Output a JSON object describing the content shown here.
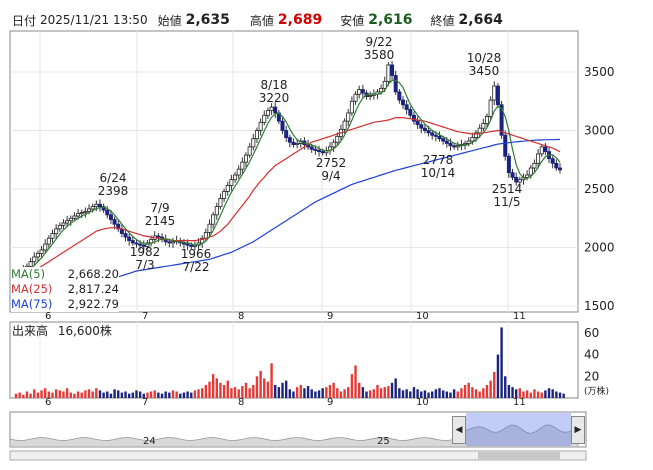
{
  "header": {
    "date_label": "日付",
    "datetime": "2025/11/21 13:50",
    "open_label": "始値",
    "open": "2,635",
    "high_label": "高値",
    "high": "2,689",
    "low_label": "安値",
    "low": "2,616",
    "close_label": "終値",
    "close": "2,664"
  },
  "colors": {
    "up": "#0a0a0a",
    "down_body": "#1a237e",
    "high": "#d50000",
    "low": "#1b5e20",
    "ma5": "#2e7d32",
    "ma25": "#d32f2f",
    "ma75": "#1e40d8",
    "vol_red": "#e53935",
    "vol_blue": "#1a237e"
  },
  "ma_legend": [
    {
      "name": "MA(5)",
      "value": "2,668.20"
    },
    {
      "name": "MA(25)",
      "value": "2,817.24"
    },
    {
      "name": "MA(75)",
      "value": "2,922.79"
    }
  ],
  "volume": {
    "label": "出来高",
    "value": "16,600株",
    "unit": "(万株)",
    "ticks": [
      "20",
      "40",
      "60"
    ]
  },
  "navigator": {
    "labels": [
      "24",
      "25"
    ]
  },
  "chart_data": {
    "type": "candlestick",
    "title": "",
    "x_month_labels": [
      "6",
      "7",
      "8",
      "9",
      "10",
      "11"
    ],
    "y_ticks": [
      1500,
      2000,
      2500,
      3000,
      3500
    ],
    "ylim": [
      1450,
      3850
    ],
    "annotations": [
      {
        "label": "6/24",
        "value": "2398"
      },
      {
        "label": "7/9",
        "value": "2145"
      },
      {
        "label": "1982",
        "value": "7/3"
      },
      {
        "label": "1966",
        "value": "7/22"
      },
      {
        "label": "8/18",
        "value": "3220"
      },
      {
        "label": "2752",
        "value": "9/4"
      },
      {
        "label": "9/22",
        "value": "3580"
      },
      {
        "label": "2778",
        "value": "10/14"
      },
      {
        "label": "10/28",
        "value": "3450"
      },
      {
        "label": "2514",
        "value": "11/5"
      }
    ],
    "close_series": [
      1760,
      1790,
      1810,
      1840,
      1880,
      1920,
      1950,
      1980,
      2030,
      2080,
      2120,
      2160,
      2190,
      2210,
      2230,
      2250,
      2270,
      2290,
      2300,
      2310,
      2330,
      2350,
      2370,
      2350,
      2320,
      2280,
      2240,
      2200,
      2160,
      2120,
      2090,
      2060,
      2040,
      2030,
      2020,
      2010,
      2040,
      2070,
      2100,
      2090,
      2070,
      2050,
      2040,
      2050,
      2060,
      2040,
      2030,
      2020,
      2010,
      2020,
      2040,
      2080,
      2130,
      2200,
      2280,
      2350,
      2420,
      2480,
      2530,
      2580,
      2620,
      2670,
      2730,
      2790,
      2860,
      2930,
      3000,
      3070,
      3130,
      3170,
      3200,
      3150,
      3080,
      3000,
      2940,
      2900,
      2880,
      2890,
      2910,
      2880,
      2860,
      2840,
      2830,
      2820,
      2810,
      2830,
      2860,
      2900,
      2950,
      3010,
      3080,
      3150,
      3250,
      3310,
      3350,
      3320,
      3290,
      3300,
      3310,
      3330,
      3360,
      3420,
      3560,
      3470,
      3330,
      3260,
      3220,
      3180,
      3130,
      3080,
      3050,
      3020,
      3000,
      2980,
      2960,
      2950,
      2930,
      2910,
      2890,
      2870,
      2860,
      2870,
      2880,
      2890,
      2910,
      2940,
      2980,
      3020,
      3060,
      3120,
      3260,
      3380,
      3220,
      2960,
      2780,
      2640,
      2600,
      2560,
      2580,
      2600,
      2620,
      2680,
      2720,
      2800,
      2860,
      2820,
      2760,
      2720,
      2680,
      2664
    ],
    "ma25": [
      1700,
      1720,
      1740,
      1760,
      1780,
      1800,
      1820,
      1840,
      1860,
      1880,
      1900,
      1920,
      1940,
      1960,
      1980,
      2000,
      2020,
      2040,
      2060,
      2080,
      2100,
      2120,
      2140,
      2150,
      2160,
      2165,
      2170,
      2170,
      2165,
      2160,
      2150,
      2140,
      2130,
      2120,
      2110,
      2100,
      2095,
      2090,
      2085,
      2080,
      2075,
      2070,
      2065,
      2060,
      2060,
      2060,
      2060,
      2060,
      2060,
      2060,
      2065,
      2070,
      2080,
      2090,
      2100,
      2120,
      2140,
      2170,
      2200,
      2240,
      2280,
      2320,
      2360,
      2400,
      2440,
      2490,
      2530,
      2570,
      2600,
      2640,
      2670,
      2700,
      2720,
      2740,
      2760,
      2780,
      2800,
      2820,
      2840,
      2860,
      2880,
      2900,
      2910,
      2920,
      2930,
      2940,
      2950,
      2960,
      2970,
      2980,
      2990,
      3000,
      3010,
      3020,
      3030,
      3040,
      3050,
      3060,
      3070,
      3075,
      3080,
      3085,
      3090,
      3100,
      3110,
      3110,
      3110,
      3105,
      3100,
      3095,
      3090,
      3085,
      3080,
      3070,
      3060,
      3050,
      3040,
      3030,
      3020,
      3010,
      3000,
      2990,
      2985,
      2980,
      2975,
      2970,
      2970,
      2975,
      2980,
      2985,
      2990,
      2995,
      3000,
      2990,
      2980,
      2970,
      2960,
      2950,
      2940,
      2930,
      2920,
      2910,
      2900,
      2890,
      2880,
      2870,
      2860,
      2850,
      2835,
      2817
    ],
    "ma75": [
      1550,
      1555,
      1560,
      1565,
      1570,
      1575,
      1580,
      1585,
      1590,
      1595,
      1600,
      1605,
      1610,
      1615,
      1620,
      1625,
      1630,
      1640,
      1650,
      1660,
      1670,
      1680,
      1690,
      1700,
      1710,
      1720,
      1730,
      1740,
      1750,
      1760,
      1770,
      1780,
      1790,
      1800,
      1805,
      1810,
      1815,
      1820,
      1825,
      1830,
      1835,
      1840,
      1845,
      1850,
      1855,
      1860,
      1865,
      1870,
      1875,
      1880,
      1885,
      1890,
      1895,
      1900,
      1910,
      1920,
      1930,
      1940,
      1950,
      1960,
      1975,
      1990,
      2005,
      2020,
      2035,
      2050,
      2070,
      2090,
      2110,
      2130,
      2150,
      2170,
      2190,
      2210,
      2230,
      2250,
      2270,
      2290,
      2310,
      2330,
      2350,
      2370,
      2390,
      2405,
      2420,
      2435,
      2450,
      2465,
      2480,
      2495,
      2510,
      2525,
      2540,
      2550,
      2560,
      2570,
      2580,
      2590,
      2600,
      2610,
      2620,
      2630,
      2640,
      2650,
      2660,
      2668,
      2676,
      2684,
      2692,
      2700,
      2708,
      2716,
      2724,
      2732,
      2740,
      2748,
      2756,
      2764,
      2772,
      2780,
      2788,
      2796,
      2804,
      2812,
      2820,
      2828,
      2836,
      2844,
      2852,
      2860,
      2868,
      2876,
      2884,
      2888,
      2892,
      2896,
      2900,
      2903,
      2906,
      2909,
      2912,
      2915,
      2917,
      2919,
      2920,
      2921,
      2922,
      2922,
      2923,
      2923
    ],
    "volume_series": [
      4,
      5,
      3,
      6,
      4,
      8,
      5,
      7,
      9,
      6,
      5,
      8,
      7,
      6,
      9,
      5,
      4,
      6,
      5,
      7,
      8,
      6,
      9,
      7,
      5,
      6,
      4,
      8,
      7,
      5,
      6,
      4,
      5,
      7,
      6,
      4,
      5,
      6,
      7,
      5,
      4,
      6,
      5,
      7,
      6,
      4,
      5,
      6,
      5,
      7,
      8,
      9,
      12,
      15,
      22,
      18,
      14,
      12,
      16,
      9,
      10,
      8,
      11,
      14,
      9,
      12,
      20,
      25,
      18,
      15,
      32,
      12,
      10,
      14,
      16,
      8,
      6,
      10,
      12,
      9,
      11,
      8,
      6,
      7,
      9,
      10,
      12,
      14,
      9,
      6,
      8,
      10,
      22,
      30,
      14,
      10,
      6,
      7,
      8,
      12,
      9,
      10,
      11,
      14,
      18,
      9,
      7,
      8,
      6,
      10,
      8,
      6,
      7,
      5,
      6,
      8,
      9,
      7,
      6,
      5,
      8,
      6,
      9,
      12,
      14,
      10,
      8,
      6,
      9,
      12,
      16,
      24,
      40,
      65,
      20,
      12,
      10,
      8,
      9,
      6,
      7,
      5,
      8,
      6,
      5,
      7,
      9,
      8,
      6,
      5,
      4
    ]
  }
}
